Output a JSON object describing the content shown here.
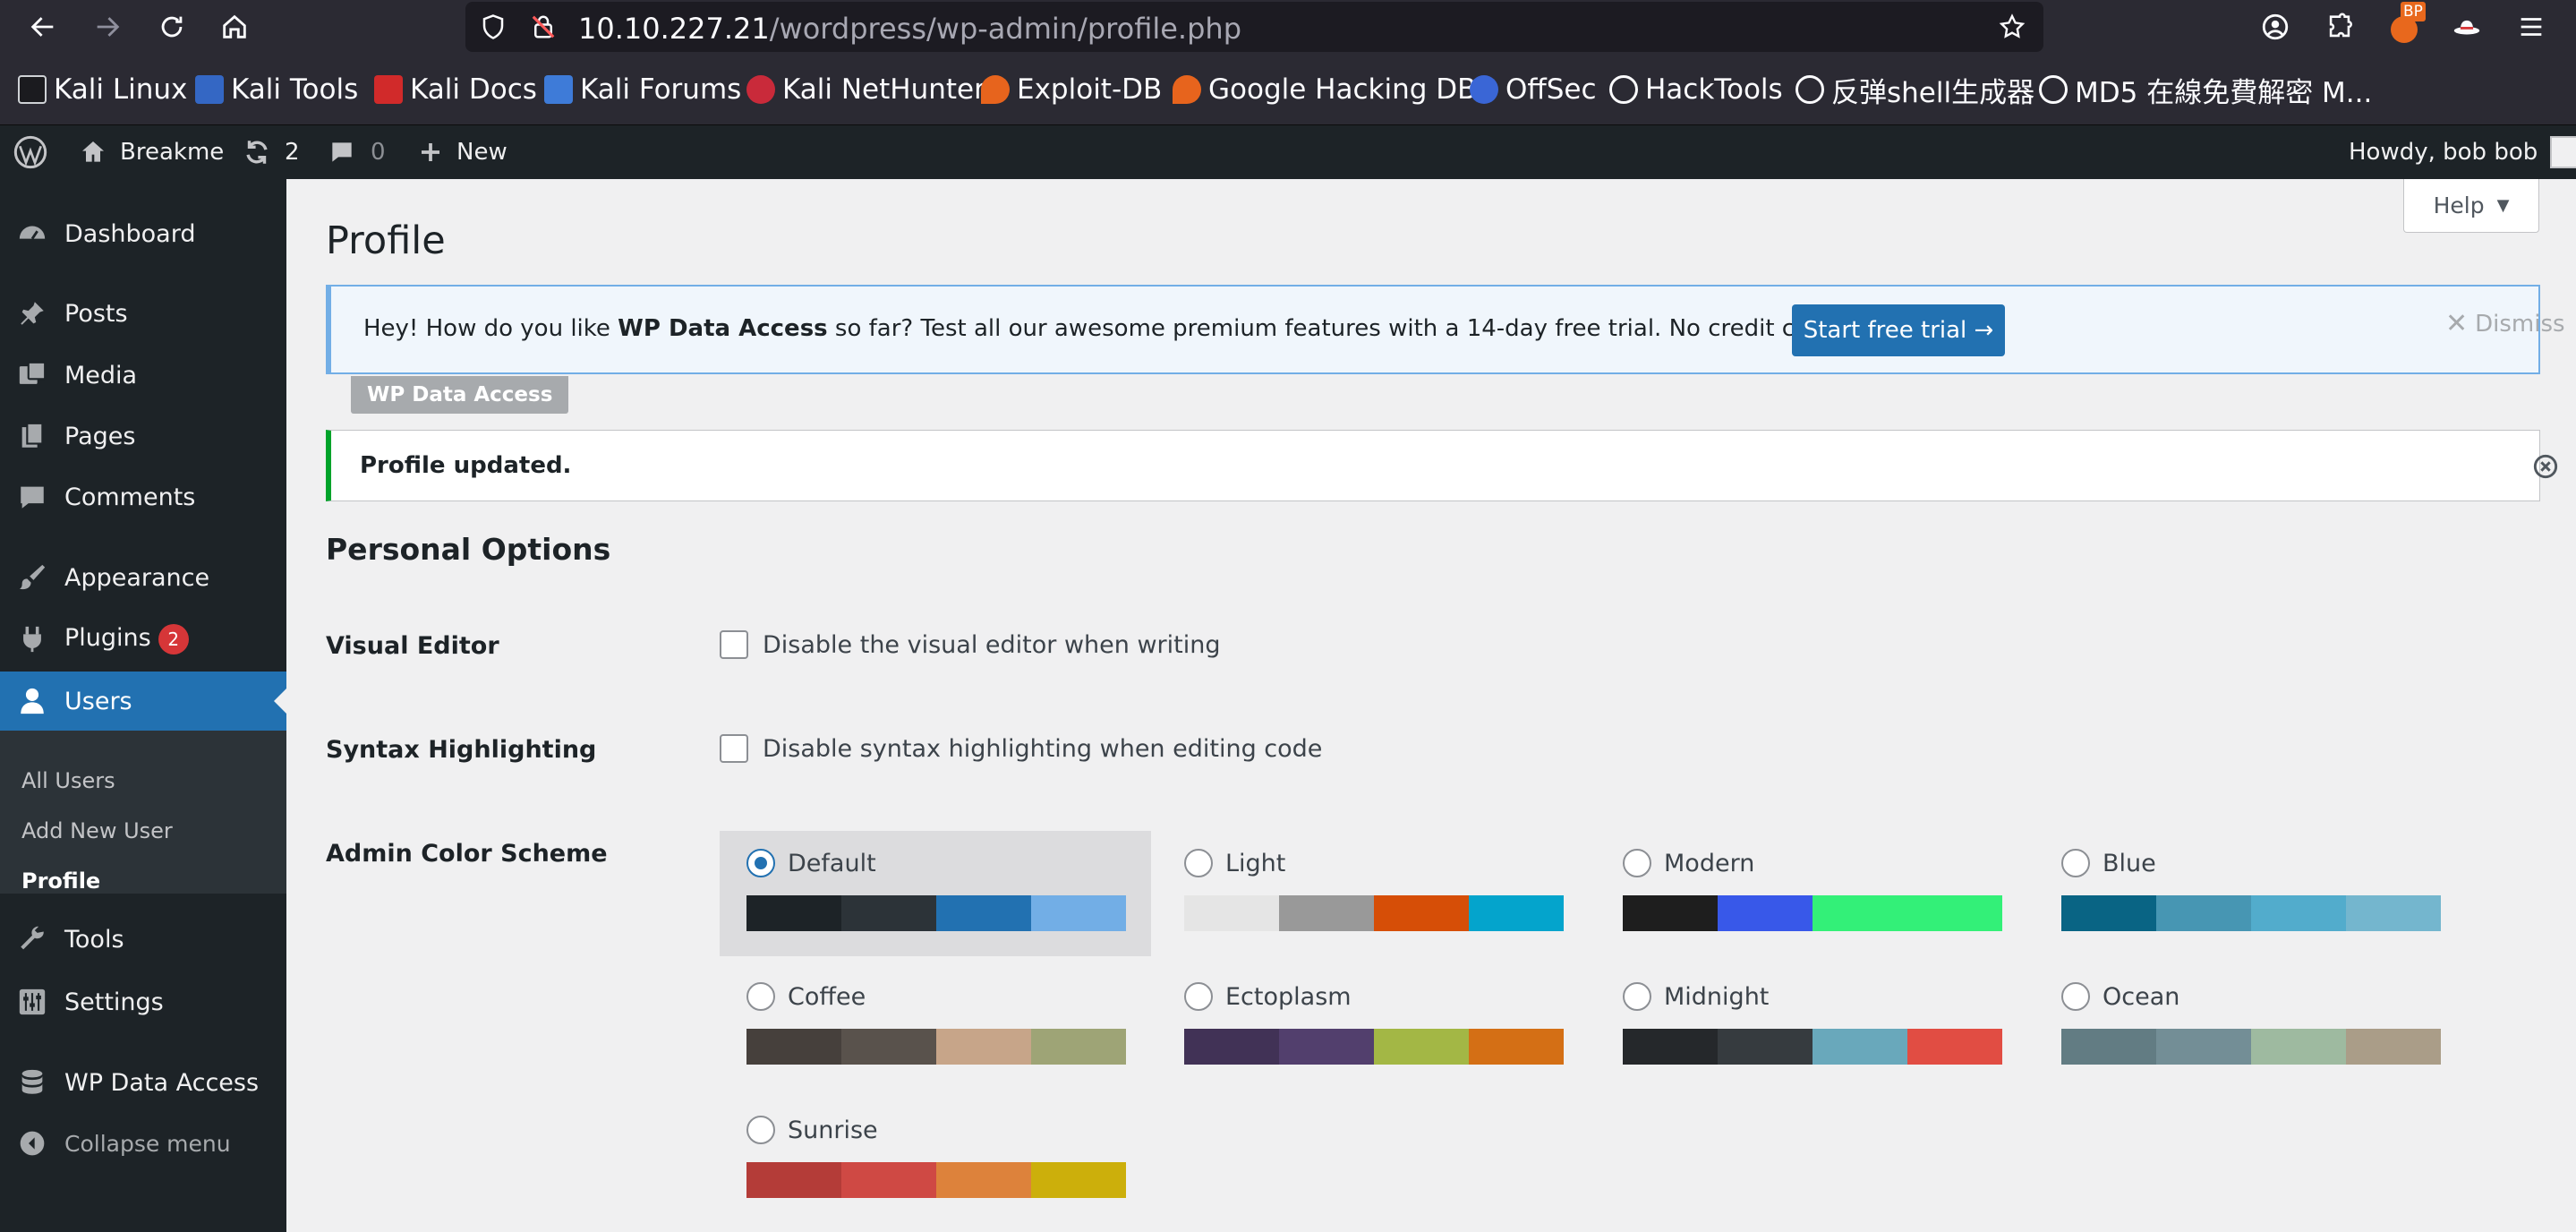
{
  "browser": {
    "url_host": "10.10.227.21",
    "url_path": "/wordpress/wp-admin/profile.php",
    "extension_badge": "BP",
    "bookmarks": [
      "Kali Linux",
      "Kali Tools",
      "Kali Docs",
      "Kali Forums",
      "Kali NetHunter",
      "Exploit-DB",
      "Google Hacking DB",
      "OffSec",
      "HackTools",
      "反弹shell生成器",
      "MD5 在線免費解密 M..."
    ]
  },
  "adminbar": {
    "site_name": "Breakme",
    "updates_count": "2",
    "comments_count": "0",
    "new_label": "New",
    "howdy": "Howdy, bob bob"
  },
  "sidebar": {
    "items": [
      {
        "label": "Dashboard",
        "icon": "dashboard-icon"
      },
      {
        "label": "Posts",
        "icon": "pin-icon"
      },
      {
        "label": "Media",
        "icon": "media-icon"
      },
      {
        "label": "Pages",
        "icon": "pages-icon"
      },
      {
        "label": "Comments",
        "icon": "comment-icon"
      },
      {
        "label": "Appearance",
        "icon": "brush-icon"
      },
      {
        "label": "Plugins",
        "icon": "plugin-icon",
        "badge": "2"
      },
      {
        "label": "Users",
        "icon": "user-icon"
      },
      {
        "label": "Tools",
        "icon": "wrench-icon"
      },
      {
        "label": "Settings",
        "icon": "settings-icon"
      },
      {
        "label": "WP Data Access",
        "icon": "database-icon"
      },
      {
        "label": "Collapse menu",
        "icon": "collapse-icon"
      }
    ],
    "submenu": [
      "All Users",
      "Add New User",
      "Profile"
    ]
  },
  "main": {
    "title": "Profile",
    "help_label": "Help",
    "trial_notice": {
      "text_before": "Hey! How do you like ",
      "text_bold": "WP Data Access",
      "text_after": " so far? Test all our awesome premium features with a 14-day free trial. No credit card required!",
      "button_label": "Start free trial →",
      "dismiss_label": "Dismiss"
    },
    "wpda_tag": "WP Data Access",
    "updated_notice": "Profile updated.",
    "section_title": "Personal Options",
    "visual_editor_label": "Visual Editor",
    "visual_editor_option": "Disable the visual editor when writing",
    "syntax_label": "Syntax Highlighting",
    "syntax_option": "Disable syntax highlighting when editing code",
    "color_scheme_label": "Admin Color Scheme",
    "color_schemes": [
      {
        "name": "Default",
        "selected": true,
        "colors": [
          "#1d2327",
          "#2c3338",
          "#2271b1",
          "#72aee6"
        ]
      },
      {
        "name": "Light",
        "selected": false,
        "colors": [
          "#e5e5e5",
          "#999999",
          "#d64e07",
          "#04a4cc"
        ]
      },
      {
        "name": "Modern",
        "selected": false,
        "colors": [
          "#1e1e1e",
          "#3858e9",
          "#33f078",
          "#33f078"
        ]
      },
      {
        "name": "Blue",
        "selected": false,
        "colors": [
          "#096484",
          "#4796b3",
          "#52accc",
          "#74b6ce"
        ]
      },
      {
        "name": "Coffee",
        "selected": false,
        "colors": [
          "#46403c",
          "#59524c",
          "#c7a589",
          "#9ea476"
        ]
      },
      {
        "name": "Ectoplasm",
        "selected": false,
        "colors": [
          "#413256",
          "#523f6d",
          "#a3b745",
          "#d46f15"
        ]
      },
      {
        "name": "Midnight",
        "selected": false,
        "colors": [
          "#25282b",
          "#363b3f",
          "#69a8bb",
          "#e14d43"
        ]
      },
      {
        "name": "Ocean",
        "selected": false,
        "colors": [
          "#627c83",
          "#738e96",
          "#9ebaa0",
          "#aa9d88"
        ]
      },
      {
        "name": "Sunrise",
        "selected": false,
        "colors": [
          "#b43c38",
          "#cf4944",
          "#dd823b",
          "#ccaf0b"
        ]
      }
    ]
  }
}
